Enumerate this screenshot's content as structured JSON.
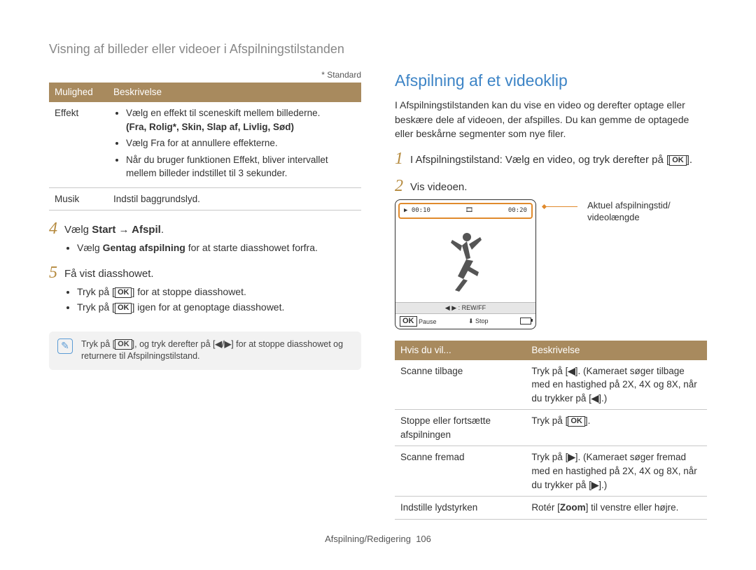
{
  "breadcrumb": "Visning af billeder eller videoer i Afspilningstilstanden",
  "left": {
    "standard_note": "* Standard",
    "table_headers": {
      "option": "Mulighed",
      "description": "Beskrivelse"
    },
    "rows": [
      {
        "option": "Effekt",
        "bullets": [
          "Vælg en effekt til sceneskift mellem billederne.",
          "Vælg Fra for at annullere effekterne.",
          "Når du bruger funktionen Effekt, bliver intervallet mellem billeder indstillet til 3 sekunder."
        ],
        "bold_options": "(Fra, Rolig*, Skin, Slap af, Livlig, Sød)"
      },
      {
        "option": "Musik",
        "plain": "Indstil baggrundslyd."
      }
    ],
    "step4": {
      "num": "4",
      "text_prefix": "Vælg ",
      "bold": "Start → Afspil",
      "suffix": "."
    },
    "step4_bullet_prefix": "Vælg ",
    "step4_bullet_bold": "Gentag afspilning",
    "step4_bullet_suffix": " for at starte diasshowet forfra.",
    "step5": {
      "num": "5",
      "text": "Få vist diasshowet."
    },
    "step5_bullets": [
      "Tryk på [OK] for at stoppe diasshowet.",
      "Tryk på [OK] igen for at genoptage diasshowet."
    ],
    "note": "Tryk på [OK], og tryk derefter på [◀/▶] for at stoppe diasshowet og returnere til Afspilningstilstand."
  },
  "right": {
    "heading": "Afspilning af et videoklip",
    "intro": "I Afspilningstilstanden kan du vise en video og derefter optage eller beskære dele af videoen, der afspilles. Du kan gemme de optagede eller beskårne segmenter som nye filer.",
    "step1": {
      "num": "1",
      "text": "I Afspilningstilstand: Vælg en video, og tryk derefter på [OK]."
    },
    "step2": {
      "num": "2",
      "text": "Vis videoen."
    },
    "video": {
      "time_current": "00:10",
      "time_total": "00:20",
      "hint": "◀ ▶ : REW/FF",
      "pause_label": "Pause",
      "stop_label": "Stop",
      "ok": "OK"
    },
    "caption": "Aktuel afspilningstid/ videolængde",
    "actions_headers": {
      "want": "Hvis du vil...",
      "desc": "Beskrivelse"
    },
    "actions": [
      {
        "want": "Scanne tilbage",
        "desc": "Tryk på [◀]. (Kameraet søger tilbage med en hastighed på 2X, 4X og 8X, når du trykker på [◀].)"
      },
      {
        "want": "Stoppe eller fortsætte afspilningen",
        "desc": "Tryk på [OK]."
      },
      {
        "want": "Scanne fremad",
        "desc": "Tryk på [▶]. (Kameraet søger fremad med en hastighed på 2X, 4X og 8X, når du trykker på [▶].)"
      },
      {
        "want": "Indstille lydstyrken",
        "desc_prefix": "Rotér [",
        "desc_bold": "Zoom",
        "desc_suffix": "] til venstre eller højre."
      }
    ]
  },
  "footer": {
    "section": "Afspilning/Redigering",
    "page": "106"
  }
}
